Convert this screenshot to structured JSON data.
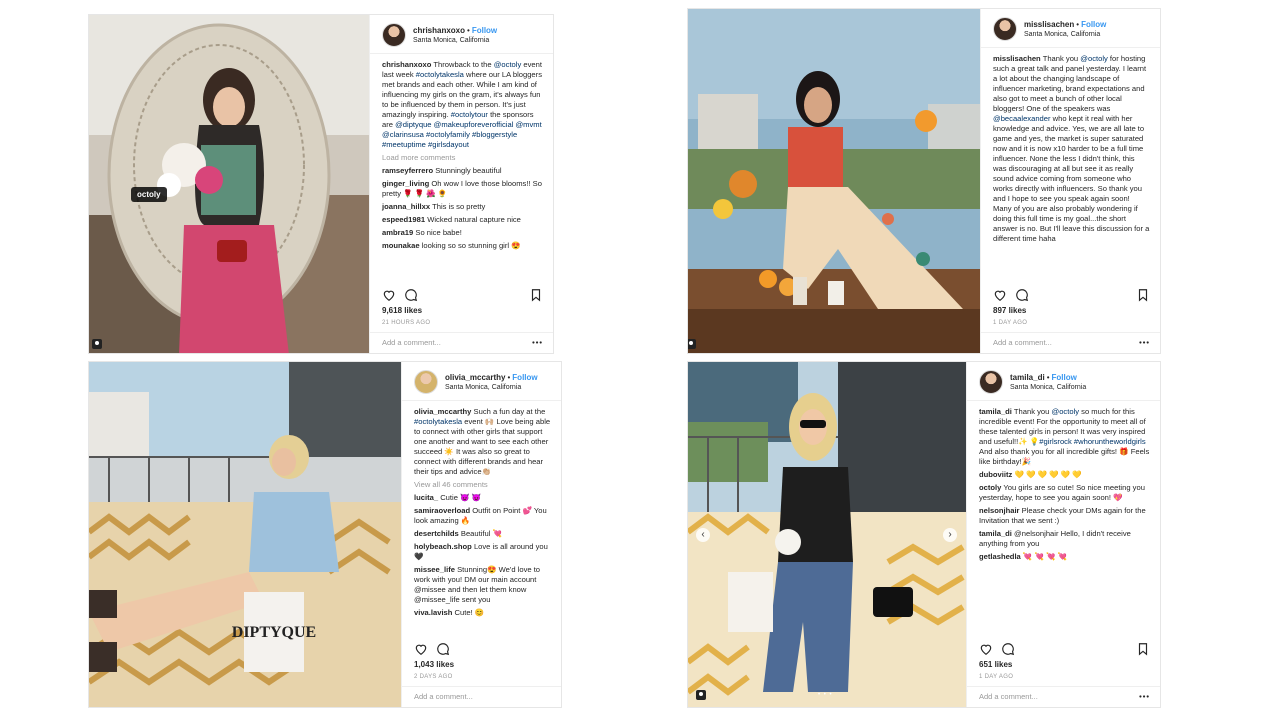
{
  "posts": [
    {
      "username": "chrishanxoxo",
      "follow_label": "Follow",
      "location": "Santa Monica, California",
      "caption_user": "chrishanxoxo",
      "caption_parts": [
        {
          "t": "Throwback to the "
        },
        {
          "t": "@octoly",
          "tag": true
        },
        {
          "t": " event last week "
        },
        {
          "t": "#octolytakesla",
          "tag": true
        },
        {
          "t": " where our LA bloggers met brands and each other. While I am kind of influencing my girls on the gram, it's always fun to be influenced by them in person. It's just amazingly inspiring. "
        },
        {
          "t": "#octolytour",
          "tag": true
        },
        {
          "t": " the sponsors are "
        },
        {
          "t": "@diptyque @makeupforeverofficial @mvmt @clarinsusa #octolyfamily #bloggerstyle #meetuptime #girlsdayout",
          "tag": true
        }
      ],
      "more_comments": "Load more comments",
      "comments": [
        {
          "user": "ramseyferrero",
          "text": "Stunningly beautiful"
        },
        {
          "user": "ginger_living",
          "text": "Oh wow I love those blooms!! So pretty 🌹 🌹 🌺 🌻"
        },
        {
          "user": "joanna_hillxx",
          "text": "This is so pretty"
        },
        {
          "user": "espeed1981",
          "text": "Wicked natural capture nice"
        },
        {
          "user": "ambra19",
          "text": "So nice babe!"
        },
        {
          "user": "mounakae",
          "text": "looking so so stunning girl 😍"
        }
      ],
      "likes": "9,618 likes",
      "age": "21 HOURS AGO",
      "add_comment": "Add a comment...",
      "photo_tag": "octoly"
    },
    {
      "username": "misslisachen",
      "follow_label": "Follow",
      "location": "Santa Monica, California",
      "caption_user": "misslisachen",
      "caption_parts": [
        {
          "t": "Thank you "
        },
        {
          "t": "@octoly",
          "tag": true
        },
        {
          "t": " for hosting such a great talk and panel yesterday. I learnt a lot about the changing landscape of influencer marketing, brand expectations and also got to meet a bunch of other local bloggers! One of the speakers was "
        },
        {
          "t": "@becaalexander",
          "tag": true
        },
        {
          "t": " who kept it real with her knowledge and advice. Yes, we are all late to game and yes, the market is super saturated now and it is now x10 harder to be a full time influencer. None the less I didn't think, this was discouraging at all but see it as really sound advice coming from someone who works directly with influencers. So thank you and I hope to see you speak again soon! Many of you are also probably wondering if doing this full time is my goal...the short answer is no. But I'll leave this discussion for a different time haha"
        }
      ],
      "likes": "897 likes",
      "age": "1 DAY AGO",
      "add_comment": "Add a comment..."
    },
    {
      "username": "olivia_mccarthy",
      "follow_label": "Follow",
      "location": "Santa Monica, California",
      "caption_user": "olivia_mccarthy",
      "caption_parts": [
        {
          "t": "Such a fun day at the "
        },
        {
          "t": "#octolytakesla",
          "tag": true
        },
        {
          "t": " event 🙌🏼 Love being able to connect with other girls that support one another and want to see each other succeed ☀️ It was also so great to connect with different brands and hear their tips and advice👏🏼"
        }
      ],
      "more_comments": "View all 46 comments",
      "comments": [
        {
          "user": "lucita_",
          "text": "Cutie 😈 😈"
        },
        {
          "user": "samiraoverload",
          "text": "Outfit on Point 💕 You look amazing 🔥"
        },
        {
          "user": "desertchilds",
          "text": "Beautiful 💘"
        },
        {
          "user": "holybeach.shop",
          "text": "Love is all around you 🖤"
        },
        {
          "user": "missee_life",
          "text": "Stunning😍 We'd love to work with you! DM our main account @missee and then let them know @missee_life sent you"
        },
        {
          "user": "viva.lavish",
          "text": "Cute! 😊"
        }
      ],
      "likes": "1,043 likes",
      "age": "2 DAYS AGO",
      "add_comment": "Add a comment..."
    },
    {
      "username": "tamila_di",
      "follow_label": "Follow",
      "location": "Santa Monica, California",
      "caption_user": "tamila_di",
      "caption_parts": [
        {
          "t": "Thank you "
        },
        {
          "t": "@octoly",
          "tag": true
        },
        {
          "t": " so much for this incredible event! For the opportunity to meet all of these talented girls in person! It was very inspired and useful!!✨ "
        },
        {
          "t": "💡#girlsrock #whoruntheworldgirls",
          "tag": true
        },
        {
          "t": " And also thank you for all incredible gifts! 🎁 Feels like birthday!🎉"
        }
      ],
      "comments": [
        {
          "user": "duboviitz",
          "text": "💛 💛 💛 💛 💛 💛"
        },
        {
          "user": "octoly",
          "text": "You girls are so cute! So nice meeting you yesterday, hope to see you again soon! 💖"
        },
        {
          "user": "nelsonjhair",
          "text": "Please check your DMs again for the Invitation that we sent :)"
        },
        {
          "user": "tamila_di",
          "text": "@nelsonjhair Hello, I didn't receive anything from you"
        },
        {
          "user": "getlashedla",
          "text": "💘 💘 💘 💘"
        }
      ],
      "likes": "651 likes",
      "age": "1 DAY AGO",
      "add_comment": "Add a comment..."
    }
  ]
}
